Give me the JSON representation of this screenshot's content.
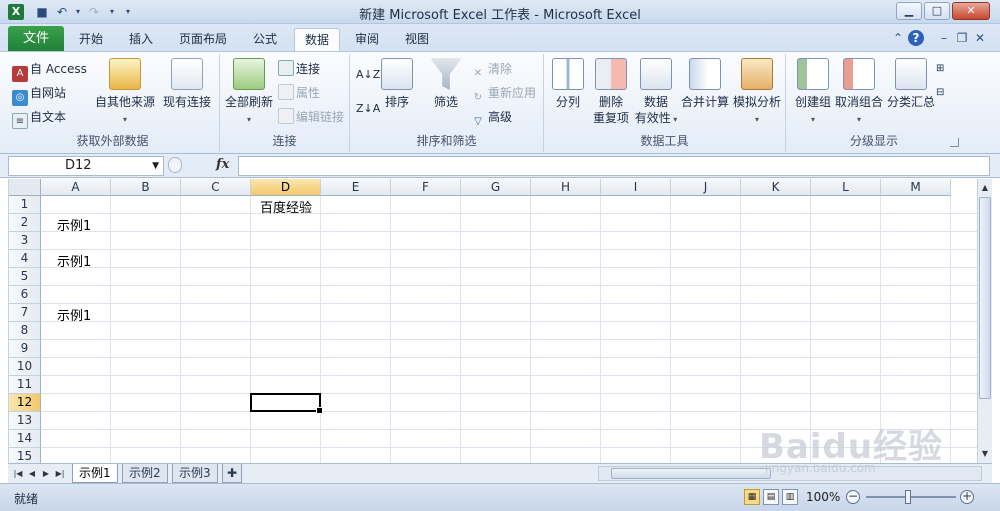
{
  "window": {
    "title": "新建 Microsoft Excel 工作表 - Microsoft Excel"
  },
  "ribbon_tabs": [
    "开始",
    "插入",
    "页面布局",
    "公式",
    "数据",
    "审阅",
    "视图"
  ],
  "file_tab": "文件",
  "active_tab": "数据",
  "groups": {
    "external": {
      "label": "获取外部数据",
      "access": "自 Access",
      "web": "自网站",
      "text": "自文本",
      "other": "自其他来源",
      "existing": "现有连接"
    },
    "connections": {
      "label": "连接",
      "refresh_all": "全部刷新",
      "connections": "连接",
      "properties": "属性",
      "edit_links": "编辑链接"
    },
    "sort_filter": {
      "label": "排序和筛选",
      "sort": "排序",
      "filter": "筛选",
      "clear": "清除",
      "reapply": "重新应用",
      "advanced": "高级"
    },
    "data_tools": {
      "label": "数据工具",
      "text_to_columns": "分列",
      "remove_dup_1": "删除",
      "remove_dup_2": "重复项",
      "validation_1": "数据",
      "validation_2": "有效性",
      "consolidate": "合并计算",
      "what_if": "模拟分析"
    },
    "outline": {
      "label": "分级显示",
      "group": "创建组",
      "ungroup": "取消组合",
      "subtotal": "分类汇总"
    }
  },
  "formula_bar": {
    "name_box": "D12",
    "fx": "fx",
    "formula": ""
  },
  "columns": [
    "A",
    "B",
    "C",
    "D",
    "E",
    "F",
    "G",
    "H",
    "I",
    "J",
    "K",
    "L",
    "M"
  ],
  "rows": [
    "1",
    "2",
    "3",
    "4",
    "5",
    "6",
    "7",
    "8",
    "9",
    "10",
    "11",
    "12",
    "13",
    "14",
    "15"
  ],
  "cells": {
    "D1": "百度经验",
    "A2": "示例1",
    "A4": "示例1",
    "A7": "示例1"
  },
  "selected_cell": "D12",
  "sheets": [
    "示例1",
    "示例2",
    "示例3"
  ],
  "active_sheet": "示例1",
  "status": {
    "ready": "就绪",
    "zoom": "100%"
  },
  "watermark": {
    "brand": "Baidu经验",
    "url": "jingyan.baidu.com"
  },
  "icons": {
    "app": "excel-icon",
    "save": "save-icon",
    "undo": "undo-icon",
    "redo": "redo-icon",
    "help": "help-icon",
    "minimize": "minimize-icon",
    "maximize": "maximize-icon",
    "close": "close-icon"
  },
  "colors": {
    "file_tab": "#2a8f42",
    "selection_header": "#f3c86a",
    "ribbon_bg": "#e4ecf7"
  }
}
